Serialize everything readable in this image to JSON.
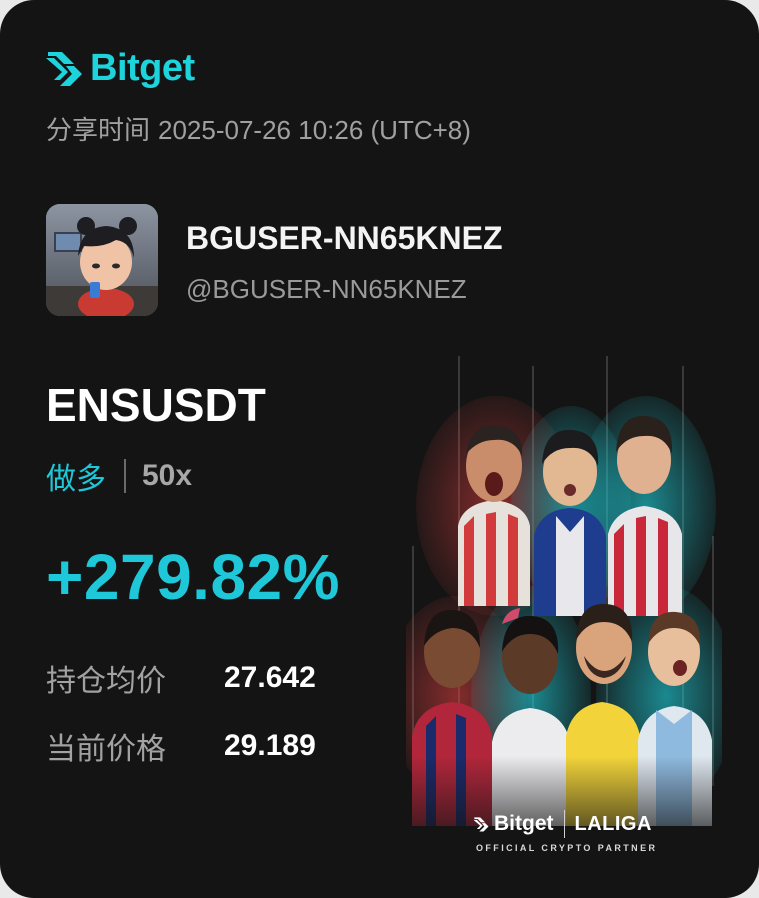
{
  "brand": {
    "name": "Bitget",
    "accent_color": "#1ed4dc",
    "logo_icon": "bitget-logo-icon"
  },
  "share": {
    "label": "分享时间",
    "time": "2025-07-26 10:26 (UTC+8)"
  },
  "user": {
    "avatar_icon": "avatar-image",
    "name": "BGUSER-NN65KNEZ",
    "handle": "@BGUSER-NN65KNEZ"
  },
  "trade": {
    "symbol": "ENSUSDT",
    "side": "做多",
    "leverage": "50x",
    "pnl_percent": "+279.82%",
    "avg_price_label": "持仓均价",
    "avg_price": "27.642",
    "current_price_label": "当前价格",
    "current_price": "29.189",
    "positive_color": "#1ec8d8"
  },
  "promo": {
    "image_icon": "laliga-players-promo-image",
    "brand_left": "Bitget",
    "brand_right": "LALIGA",
    "tagline": "OFFICIAL CRYPTO PARTNER"
  }
}
